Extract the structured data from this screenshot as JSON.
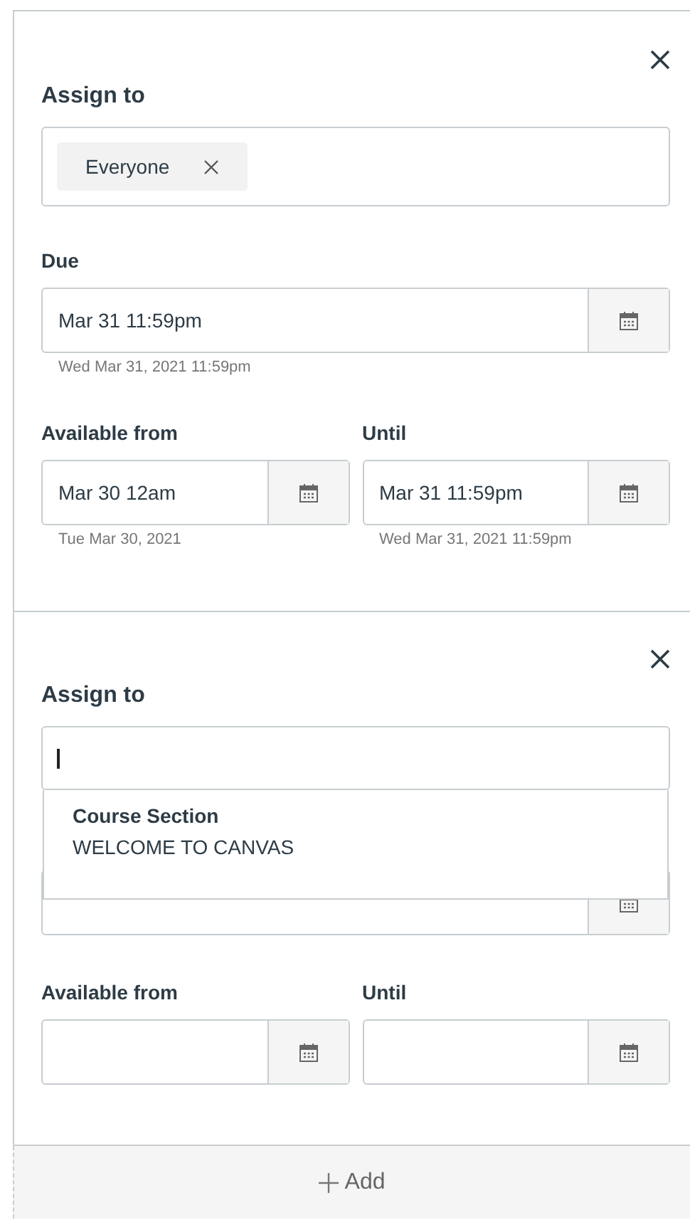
{
  "cards": [
    {
      "assign_label": "Assign to",
      "assign": {
        "focused": false,
        "chips": [
          "Everyone"
        ]
      },
      "due": {
        "label": "Due",
        "value": "Mar 31 11:59pm",
        "hint": "Wed Mar 31, 2021 11:59pm"
      },
      "available": {
        "label": "Available from",
        "value": "Mar 30 12am",
        "hint": "Tue Mar 30, 2021"
      },
      "until": {
        "label": "Until",
        "value": "Mar 31 11:59pm",
        "hint": "Wed Mar 31, 2021 11:59pm"
      }
    },
    {
      "assign_label": "Assign to",
      "assign": {
        "focused": true
      },
      "dropdown": {
        "group": "Course Section",
        "options": [
          "WELCOME TO CANVAS"
        ]
      },
      "available": {
        "label": "Available from"
      },
      "until": {
        "label": "Until"
      }
    }
  ],
  "add_button": "Add"
}
